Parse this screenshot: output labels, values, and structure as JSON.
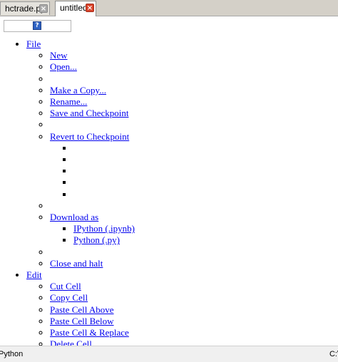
{
  "tabs": [
    {
      "label": "hctrade.py",
      "active": false
    },
    {
      "label": "untitled",
      "active": true
    }
  ],
  "toolbar": {
    "help_icon_glyph": "?"
  },
  "menu": {
    "file": {
      "label": "File",
      "items": {
        "new": "New",
        "open": "Open...",
        "make_copy": "Make a Copy...",
        "rename": "Rename...",
        "save_checkpoint": "Save and Checkpoint",
        "revert_checkpoint": "Revert to Checkpoint",
        "download_as": "Download as",
        "download_ipynb": "IPython (.ipynb)",
        "download_py": "Python (.py)",
        "close_halt": "Close and halt"
      }
    },
    "edit": {
      "label": "Edit",
      "items": {
        "cut_cell": "Cut Cell",
        "copy_cell": "Copy Cell",
        "paste_above": "Paste Cell Above",
        "paste_below": "Paste Cell Below",
        "paste_replace": "Paste Cell & Replace",
        "delete_cell_partial": "Delete Cell"
      }
    }
  },
  "status": {
    "language": "Python",
    "path": "C:\\"
  },
  "colors": {
    "link": "#0000ee",
    "active_tab_close": "#d9442c",
    "inactive_tab_close": "#a9a9a9"
  }
}
